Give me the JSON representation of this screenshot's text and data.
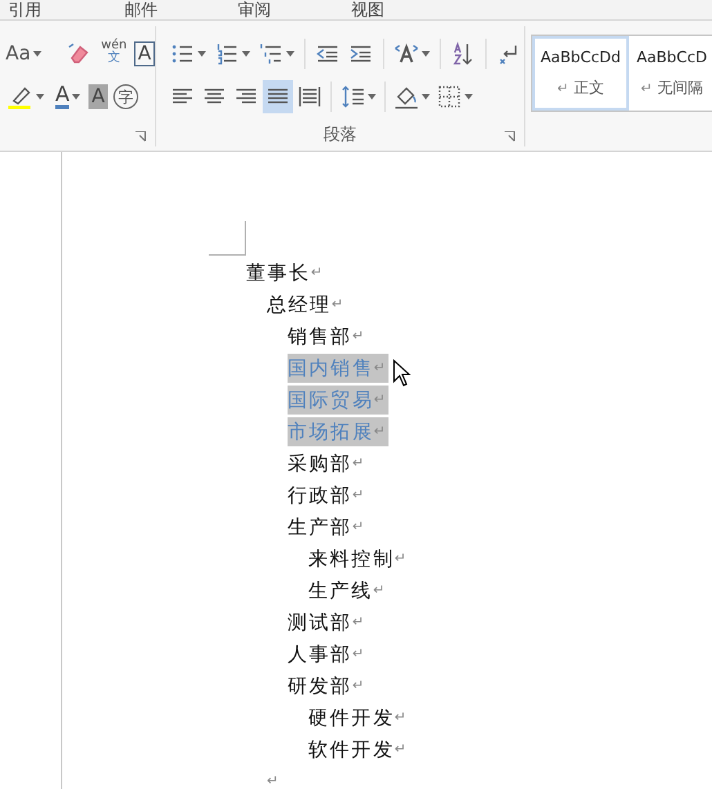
{
  "tabs": [
    {
      "label": "引用"
    },
    {
      "label": "邮件"
    },
    {
      "label": "审阅"
    },
    {
      "label": "视图"
    }
  ],
  "font_group": {
    "change_case": "Aa",
    "phonetic_top": "wén",
    "phonetic_bottom": "文",
    "char_border": "A",
    "font_color": "A",
    "char_shading": "A",
    "enclose": "字"
  },
  "paragraph_group": {
    "label": "段落",
    "alignment": [
      {
        "kind": "left",
        "selected": false
      },
      {
        "kind": "center",
        "selected": false
      },
      {
        "kind": "right",
        "selected": false
      },
      {
        "kind": "justify",
        "selected": true
      },
      {
        "kind": "distributed",
        "selected": false
      }
    ]
  },
  "styles": [
    {
      "sample": "AaBbCcDd",
      "mark": "↵",
      "name": "正文",
      "selected": true
    },
    {
      "sample": "AaBbCcD",
      "mark": "↵",
      "name": "无间隔",
      "selected": false
    }
  ],
  "document": {
    "outline": [
      {
        "text": "董事长",
        "mark": "↵",
        "selected": false,
        "children": [
          {
            "text": "总经理",
            "mark": "↵",
            "selected": false,
            "children": [
              {
                "text": "销售部",
                "mark": "↵",
                "selected": false
              },
              {
                "text": "国内销售",
                "mark": "↵",
                "selected": true
              },
              {
                "text": "国际贸易",
                "mark": "↵",
                "selected": true
              },
              {
                "text": "市场拓展",
                "mark": "↵",
                "selected": true
              },
              {
                "text": "采购部",
                "mark": "↵",
                "selected": false
              },
              {
                "text": "行政部",
                "mark": "↵",
                "selected": false
              },
              {
                "text": "生产部",
                "mark": "↵",
                "selected": false,
                "children": [
                  {
                    "text": "来料控制",
                    "mark": "↵",
                    "selected": false
                  },
                  {
                    "text": "生产线",
                    "mark": "↵",
                    "selected": false
                  }
                ]
              },
              {
                "text": "测试部",
                "mark": "↵",
                "selected": false
              },
              {
                "text": "人事部",
                "mark": "↵",
                "selected": false
              },
              {
                "text": "研发部",
                "mark": "↵",
                "selected": false,
                "children": [
                  {
                    "text": "硬件开发",
                    "mark": "↵",
                    "selected": false
                  },
                  {
                    "text": "软件开发",
                    "mark": "↵",
                    "selected": false
                  }
                ]
              }
            ]
          }
        ]
      }
    ],
    "end_mark": "↵"
  }
}
